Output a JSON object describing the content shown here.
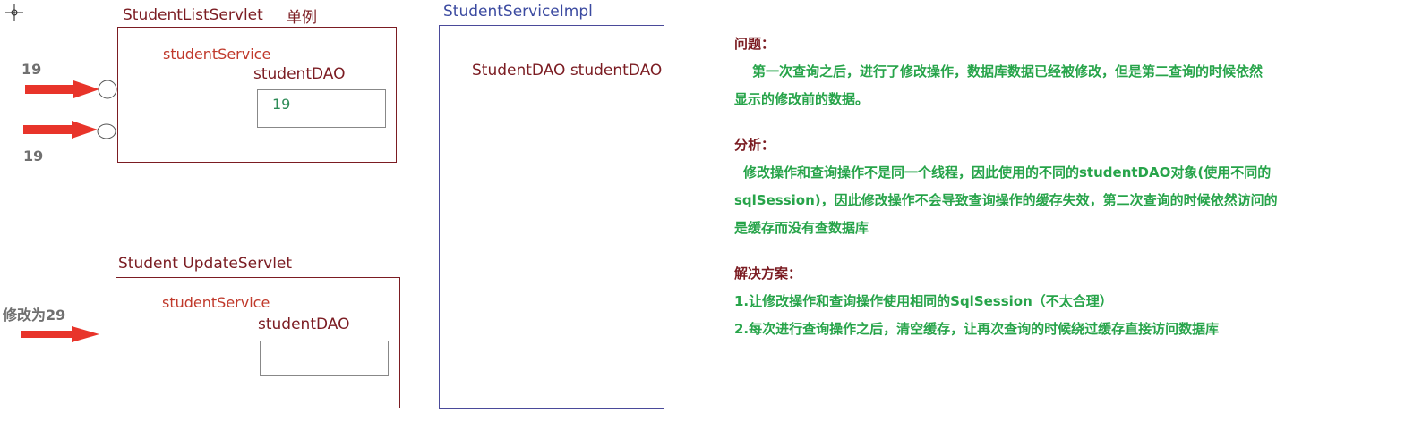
{
  "diagram": {
    "singleton_label": "单例",
    "student_list_servlet": {
      "title": "StudentListServlet",
      "service_label": "studentService",
      "dao_label": "studentDAO",
      "dao_value": "19"
    },
    "student_update_servlet": {
      "title": "Student UpdateServlet",
      "service_label": "studentService",
      "dao_label": "studentDAO",
      "dao_value": ""
    },
    "student_service_impl": {
      "title": "StudentServiceImpl",
      "field_label": "StudentDAO studentDAO"
    },
    "arrows": {
      "top_request_value": "19",
      "bottom_request_value": "19",
      "update_request_label": "修改为29"
    },
    "colors": {
      "arrow": "#e8342a",
      "box_border": "#7b1c22",
      "impl_border": "#4a4a9a",
      "notes_text": "#27a44a",
      "notes_heading": "#7b1c22"
    }
  },
  "notes": {
    "problem_heading": "问题：",
    "problem_lines": [
      "第一次查询之后，进行了修改操作，数据库数据已经被修改，但是第二查询的时候依然",
      "显示的修改前的数据。"
    ],
    "analysis_heading": "分析：",
    "analysis_lines": [
      "修改操作和查询操作不是同一个线程，因此使用的不同的studentDAO对象(使用不同的",
      "sqlSession)，因此修改操作不会导致查询操作的缓存失效，第二次查询的时候依然访问的",
      "是缓存而没有查数据库"
    ],
    "solution_heading": "解决方案：",
    "solution_lines": [
      "1.让修改操作和查询操作使用相同的SqlSession（不太合理）",
      "2.每次进行查询操作之后，清空缓存，让再次查询的时候绕过缓存直接访问数据库"
    ]
  }
}
